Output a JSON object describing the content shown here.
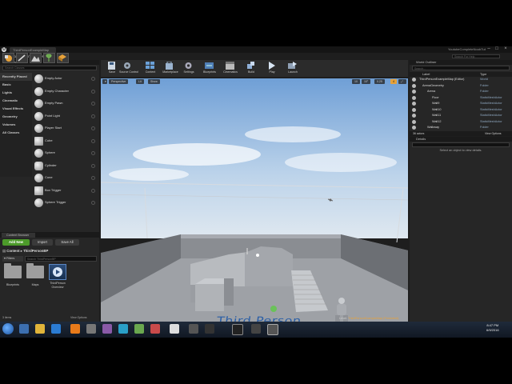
{
  "titlebar": {
    "tab": "ThirdPersonExampleMap",
    "project": "YoutubeCompleteNoobTut"
  },
  "menu": [
    "File",
    "Edit",
    "Window",
    "Help"
  ],
  "help_search_placeholder": "Search For Help",
  "modes": {
    "title": "Modes",
    "search_placeholder": "Search Classes",
    "categories": [
      "Recently Placed",
      "Basic",
      "Lights",
      "Cinematic",
      "Visual Effects",
      "Geometry",
      "Volumes",
      "All Classes"
    ],
    "items": [
      "Empty Actor",
      "Empty Character",
      "Empty Pawn",
      "Point Light",
      "Player Start",
      "Cube",
      "Sphere",
      "Cylinder",
      "Cone",
      "Box Trigger",
      "Sphere Trigger"
    ]
  },
  "toolbar": [
    "Save",
    "Source Control",
    "Content",
    "Marketplace",
    "Settings",
    "Blueprints",
    "Cinematics",
    "Build",
    "Play",
    "Launch"
  ],
  "viewport": {
    "view_mode": "Perspective",
    "lit_mode": "Lit",
    "show": "Show",
    "snap_value": "10",
    "angle_value": "10°",
    "scale_value": "0.25",
    "camera_speed": "4",
    "level_label": "Level:",
    "level_name": "ThirdPersonExampleMap (Persistent)",
    "floor_text": "Third Person"
  },
  "content_browser": {
    "tab": "Content Browser",
    "add_new": "Add New",
    "import": "Import",
    "save_all": "Save All",
    "path": [
      "Content",
      "ThirdPersonBP"
    ],
    "filters": "Filters",
    "search_placeholder": "Search ThirdPersonBP",
    "assets": [
      {
        "name": "Blueprints"
      },
      {
        "name": "Maps"
      },
      {
        "name": "ThirdPerson Overview"
      }
    ],
    "item_count": "3 items",
    "view_options": "View Options"
  },
  "world_outliner": {
    "title": "World Outliner",
    "search_placeholder": "Search...",
    "col_label": "Label",
    "col_type": "Type",
    "rows": [
      {
        "name": "ThirdPersonExampleMap (Editor)",
        "type": "World"
      },
      {
        "name": "ArenaGeometry",
        "type": "Folder"
      },
      {
        "name": "Arena",
        "type": "Folder"
      },
      {
        "name": "Floor",
        "type": "StaticMeshActor"
      },
      {
        "name": "Wall9",
        "type": "StaticMeshActor"
      },
      {
        "name": "Wall10",
        "type": "StaticMeshActor"
      },
      {
        "name": "Wall11",
        "type": "StaticMeshActor"
      },
      {
        "name": "Wall12",
        "type": "StaticMeshActor"
      },
      {
        "name": "Walkway",
        "type": "Folder"
      }
    ],
    "actors_count": "36 actors",
    "view_options": "View Options"
  },
  "details": {
    "title": "Details",
    "message": "Select an object to view details."
  },
  "clock": {
    "time": "8:47 PM",
    "date": "6/9/2016"
  },
  "colors": {
    "add_new": "#4c9a2a",
    "accent": "#e7a23a",
    "selection": "#2d5a8c"
  }
}
